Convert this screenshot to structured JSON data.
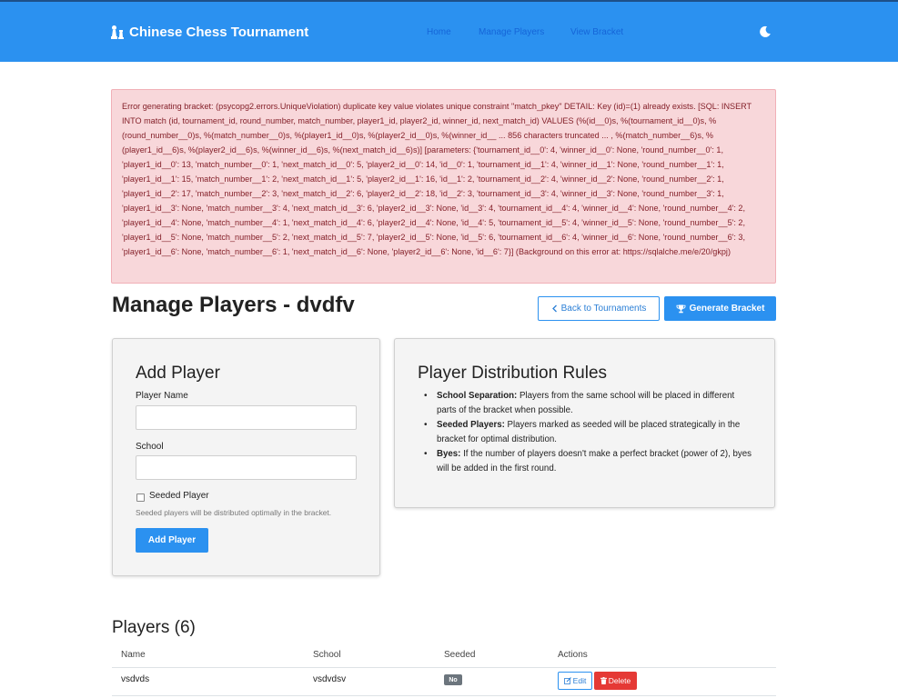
{
  "nav": {
    "brand": "Chinese Chess Tournament",
    "links": [
      "Home",
      "Manage Players",
      "View Bracket"
    ]
  },
  "alert": {
    "message": "Error generating bracket: (psycopg2.errors.UniqueViolation) duplicate key value violates unique constraint \"match_pkey\" DETAIL: Key (id)=(1) already exists. [SQL: INSERT INTO match (id, tournament_id, round_number, match_number, player1_id, player2_id, winner_id, next_match_id) VALUES (%(id__0)s, %(tournament_id__0)s, %(round_number__0)s, %(match_number__0)s, %(player1_id__0)s, %(player2_id__0)s, %(winner_id__ ... 856 characters truncated ... , %(match_number__6)s, %(player1_id__6)s, %(player2_id__6)s, %(winner_id__6)s, %(next_match_id__6)s)] [parameters: {'tournament_id__0': 4, 'winner_id__0': None, 'round_number__0': 1, 'player1_id__0': 13, 'match_number__0': 1, 'next_match_id__0': 5, 'player2_id__0': 14, 'id__0': 1, 'tournament_id__1': 4, 'winner_id__1': None, 'round_number__1': 1, 'player1_id__1': 15, 'match_number__1': 2, 'next_match_id__1': 5, 'player2_id__1': 16, 'id__1': 2, 'tournament_id__2': 4, 'winner_id__2': None, 'round_number__2': 1, 'player1_id__2': 17, 'match_number__2': 3, 'next_match_id__2': 6, 'player2_id__2': 18, 'id__2': 3, 'tournament_id__3': 4, 'winner_id__3': None, 'round_number__3': 1, 'player1_id__3': None, 'match_number__3': 4, 'next_match_id__3': 6, 'player2_id__3': None, 'id__3': 4, 'tournament_id__4': 4, 'winner_id__4': None, 'round_number__4': 2, 'player1_id__4': None, 'match_number__4': 1, 'next_match_id__4': 6, 'player2_id__4': None, 'id__4': 5, 'tournament_id__5': 4, 'winner_id__5': None, 'round_number__5': 2, 'player1_id__5': None, 'match_number__5': 2, 'next_match_id__5': 7, 'player2_id__5': None, 'id__5': 6, 'tournament_id__6': 4, 'winner_id__6': None, 'round_number__6': 3, 'player1_id__6': None, 'match_number__6': 1, 'next_match_id__6': None, 'player2_id__6': None, 'id__6': 7}] (Background on this error at: https://sqlalche.me/e/20/gkpj)"
  },
  "page": {
    "title": "Manage Players - dvdfv",
    "back_label": "Back to Tournaments",
    "generate_label": "Generate Bracket"
  },
  "add_player": {
    "heading": "Add Player",
    "name_label": "Player Name",
    "name_value": "",
    "school_label": "School",
    "school_value": "",
    "seeded_label": "Seeded Player",
    "help_text": "Seeded players will be distributed optimally in the bracket.",
    "submit_label": "Add Player"
  },
  "rules": {
    "heading": "Player Distribution Rules",
    "items": [
      {
        "title": "School Separation:",
        "text": " Players from the same school will be placed in different parts of the bracket when possible."
      },
      {
        "title": "Seeded Players:",
        "text": " Players marked as seeded will be placed strategically in the bracket for optimal distribution."
      },
      {
        "title": "Byes:",
        "text": " If the number of players doesn't make a perfect bracket (power of 2), byes will be added in the first round."
      }
    ]
  },
  "players": {
    "heading": "Players (6)",
    "columns": [
      "Name",
      "School",
      "Seeded",
      "Actions"
    ],
    "rows": [
      {
        "name": "vsdvds",
        "school": "vsdvdsv",
        "seeded": "No",
        "edit_label": "Edit",
        "delete_label": "Delete"
      }
    ]
  },
  "colors": {
    "primary": "#2b91f0",
    "danger": "#e53935",
    "alert_bg": "#f8d7da",
    "alert_text": "#842029",
    "badge": "#6c757d"
  }
}
